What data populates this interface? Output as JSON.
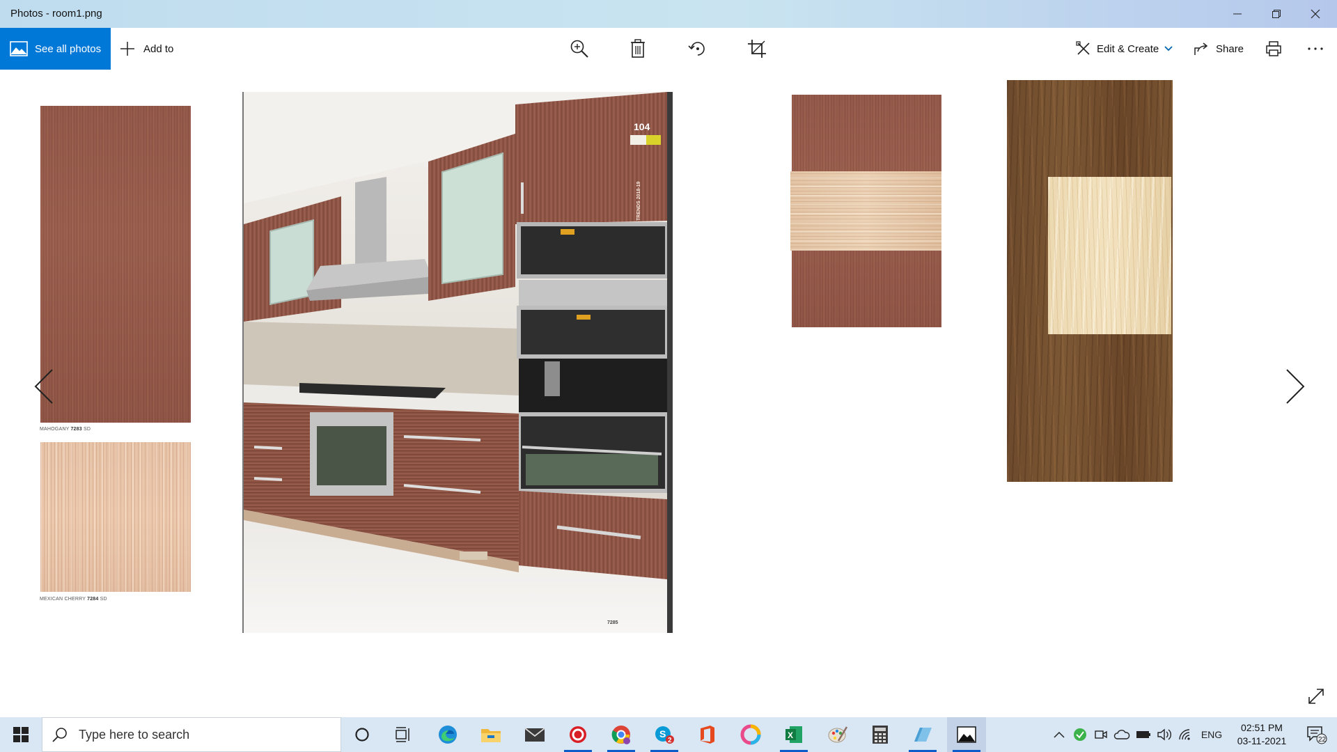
{
  "window": {
    "title": "Photos - room1.png",
    "minimize_label": "Minimize",
    "restore_label": "Restore",
    "close_label": "Close"
  },
  "toolbar": {
    "see_all_photos": "See all photos",
    "add_to": "Add to",
    "tools": [
      {
        "name": "zoom",
        "icon": "zoom-in-icon"
      },
      {
        "name": "delete",
        "icon": "trash-icon"
      },
      {
        "name": "rotate",
        "icon": "rotate-icon"
      },
      {
        "name": "crop",
        "icon": "crop-icon"
      }
    ],
    "edit_create": "Edit & Create",
    "share": "Share",
    "print_icon": "print-icon",
    "more_icon": "more-icon"
  },
  "image": {
    "swatch_left_top_caption_prefix": "MAHOGANY",
    "swatch_left_top_caption_code": "7283",
    "swatch_left_top_caption_suffix": "SD",
    "swatch_left_bottom_caption_prefix": "MEXICAN CHERRY",
    "swatch_left_bottom_caption_code": "7284",
    "swatch_left_bottom_caption_suffix": "SD",
    "kitchen_page_number": "104",
    "kitchen_brand_text": "TRENDS 2018-19",
    "kitchen_footer_code": "7285"
  },
  "taskbar": {
    "search_placeholder": "Type here to search",
    "apps": [
      "cortana-icon",
      "task-view-icon",
      "edge-icon",
      "file-explorer-icon",
      "mail-icon",
      "pdf-reader-icon",
      "chrome-icon",
      "skype-icon",
      "office-icon",
      "photo-editor-icon",
      "excel-icon",
      "paint-icon",
      "calculator-icon",
      "snipping-icon",
      "photos-icon"
    ],
    "skype_badge": "2",
    "language": "ENG",
    "time": "02:51 PM",
    "date": "03-11-2021",
    "notification_count": "22"
  },
  "colors": {
    "accent": "#0078d7",
    "taskbar": "#d9e6f4",
    "titlebar": "#c9e4f0"
  }
}
